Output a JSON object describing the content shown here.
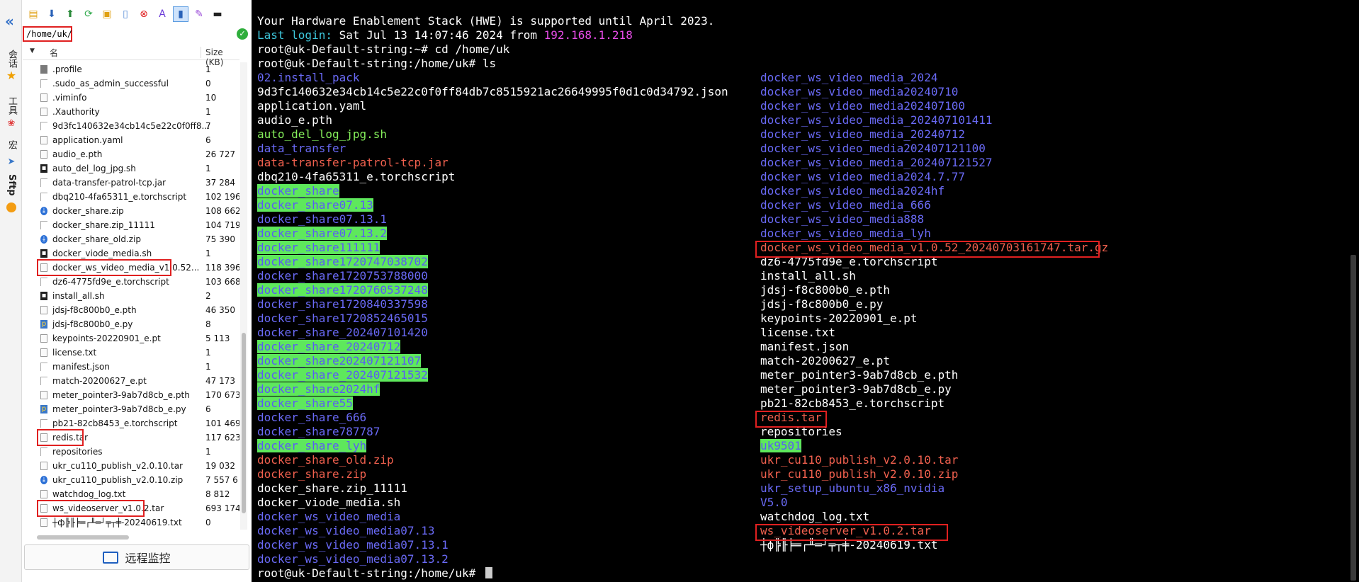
{
  "sidebar": {
    "tabs": [
      "会话",
      "工具",
      "宏",
      "Sftp"
    ]
  },
  "path": "/home/uk/",
  "columns": {
    "name": "名",
    "size": "Size (KB)"
  },
  "files": [
    {
      "name": ".profile",
      "size": "1",
      "icon": "db"
    },
    {
      "name": ".sudo_as_admin_successful",
      "size": "0",
      "icon": "blank"
    },
    {
      "name": ".viminfo",
      "size": "10",
      "icon": "doc"
    },
    {
      "name": ".Xauthority",
      "size": "1",
      "icon": "doc"
    },
    {
      "name": "9d3fc140632e34cb14c5e22c0f0ff8...",
      "size": "7",
      "icon": "blank"
    },
    {
      "name": "application.yaml",
      "size": "6",
      "icon": "doc"
    },
    {
      "name": "audio_e.pth",
      "size": "26 727",
      "icon": "doc"
    },
    {
      "name": "auto_del_log_jpg.sh",
      "size": "1",
      "icon": "term"
    },
    {
      "name": "data-transfer-patrol-tcp.jar",
      "size": "37 284",
      "icon": "blank"
    },
    {
      "name": "dbq210-4fa65311_e.torchscript",
      "size": "102 196",
      "icon": "blank"
    },
    {
      "name": "docker_share.zip",
      "size": "108 662",
      "icon": "zip"
    },
    {
      "name": "docker_share.zip_11111",
      "size": "104 719",
      "icon": "blank"
    },
    {
      "name": "docker_share_old.zip",
      "size": "75 390",
      "icon": "zip"
    },
    {
      "name": "docker_viode_media.sh",
      "size": "1",
      "icon": "term"
    },
    {
      "name": "docker_ws_video_media_v1.0.52...",
      "size": "118 396",
      "icon": "doc"
    },
    {
      "name": "dz6-4775fd9e_e.torchscript",
      "size": "103 668",
      "icon": "blank"
    },
    {
      "name": "install_all.sh",
      "size": "2",
      "icon": "term"
    },
    {
      "name": "jdsj-f8c800b0_e.pth",
      "size": "46 350",
      "icon": "doc"
    },
    {
      "name": "jdsj-f8c800b0_e.py",
      "size": "8",
      "icon": "py"
    },
    {
      "name": "keypoints-20220901_e.pt",
      "size": "5 113",
      "icon": "doc"
    },
    {
      "name": "license.txt",
      "size": "1",
      "icon": "doc"
    },
    {
      "name": "manifest.json",
      "size": "1",
      "icon": "blank"
    },
    {
      "name": "match-20200627_e.pt",
      "size": "47 173",
      "icon": "blank"
    },
    {
      "name": "meter_pointer3-9ab7d8cb_e.pth",
      "size": "170 673",
      "icon": "doc"
    },
    {
      "name": "meter_pointer3-9ab7d8cb_e.py",
      "size": "6",
      "icon": "py"
    },
    {
      "name": "pb21-82cb8453_e.torchscript",
      "size": "101 469",
      "icon": "blank"
    },
    {
      "name": "redis.tar",
      "size": "117 623",
      "icon": "doc"
    },
    {
      "name": "repositories",
      "size": "1",
      "icon": "blank"
    },
    {
      "name": "ukr_cu110_publish_v2.0.10.tar",
      "size": "19 032",
      "icon": "doc"
    },
    {
      "name": "ukr_cu110_publish_v2.0.10.zip",
      "size": "7 557 6",
      "icon": "zip"
    },
    {
      "name": "watchdog_log.txt",
      "size": "8 812",
      "icon": "doc"
    },
    {
      "name": "ws_videoserver_v1.0.2.tar",
      "size": "693 174",
      "icon": "doc"
    },
    {
      "name": "┼ф╠╟╞═┌╨═┘╤┬╪-20240619.txt",
      "size": "0",
      "icon": "doc"
    }
  ],
  "monitor_label": "远程监控",
  "terminal": {
    "hwe": "Your Hardware Enablement Stack (HWE) is supported until April 2023.",
    "login_label": "Last login:",
    "login_date": " Sat Jul 13 14:07:46 2024 from ",
    "login_ip": "192.168.1.218",
    "prompt_home": "root@uk-Default-string:~# ",
    "cmd_cd": "cd /home/uk",
    "prompt_uk": "root@uk-Default-string:/home/uk# ",
    "cmd_ls": "ls",
    "col1": [
      {
        "t": "02.install_pack",
        "c": "dir"
      },
      {
        "t": "9d3fc140632e34cb14c5e22c0f0ff84db7c8515921ac26649995f0d1c0d34792.json",
        "c": "w"
      },
      {
        "t": "application.yaml",
        "c": "w"
      },
      {
        "t": "audio_e.pth",
        "c": "w"
      },
      {
        "t": "auto_del_log_jpg.sh",
        "c": "exec"
      },
      {
        "t": "data_transfer",
        "c": "dir"
      },
      {
        "t": "data-transfer-patrol-tcp.jar",
        "c": "red"
      },
      {
        "t": "dbq210-4fa65311_e.torchscript",
        "c": "w"
      },
      {
        "t": "docker_share",
        "c": "g"
      },
      {
        "t": "docker_share07.13",
        "c": "g"
      },
      {
        "t": "docker_share07.13.1",
        "c": "dir"
      },
      {
        "t": "docker_share07.13.2",
        "c": "g"
      },
      {
        "t": "docker_share111111",
        "c": "g"
      },
      {
        "t": "docker_share1720747038702",
        "c": "g"
      },
      {
        "t": "docker_share1720753788000",
        "c": "dir"
      },
      {
        "t": "docker_share1720760537248",
        "c": "g"
      },
      {
        "t": "docker_share1720840337598",
        "c": "dir"
      },
      {
        "t": "docker_share1720852465015",
        "c": "dir"
      },
      {
        "t": "docker_share_202407101420",
        "c": "dir"
      },
      {
        "t": "docker_share_20240712",
        "c": "g"
      },
      {
        "t": "docker_share202407121107",
        "c": "g"
      },
      {
        "t": "docker_share_202407121532",
        "c": "g"
      },
      {
        "t": "docker_share2024hf",
        "c": "g"
      },
      {
        "t": "docker_share55",
        "c": "g"
      },
      {
        "t": "docker_share_666",
        "c": "dir"
      },
      {
        "t": "docker_share787787",
        "c": "dir"
      },
      {
        "t": "docker_share_lyh",
        "c": "g"
      },
      {
        "t": "docker_share_old.zip",
        "c": "red"
      },
      {
        "t": "docker_share.zip",
        "c": "red"
      },
      {
        "t": "docker_share.zip_11111",
        "c": "w"
      },
      {
        "t": "docker_viode_media.sh",
        "c": "w"
      },
      {
        "t": "docker_ws_video_media",
        "c": "dir"
      },
      {
        "t": "docker_ws_video_media07.13",
        "c": "dir"
      },
      {
        "t": "docker_ws_video_media07.13.1",
        "c": "dir"
      },
      {
        "t": "docker_ws_video_media07.13.2",
        "c": "dir"
      }
    ],
    "col2": [
      {
        "t": "docker_ws_video_media_2024",
        "c": "dir"
      },
      {
        "t": "docker_ws_video_media20240710",
        "c": "dir"
      },
      {
        "t": "docker_ws_video_media202407100",
        "c": "dir"
      },
      {
        "t": "docker_ws_video_media_202407101411",
        "c": "dir"
      },
      {
        "t": "docker_ws_video_media_20240712",
        "c": "dir"
      },
      {
        "t": "docker_ws_video_media202407121100",
        "c": "dir"
      },
      {
        "t": "docker_ws_video_media_202407121527",
        "c": "dir"
      },
      {
        "t": "docker_ws_video_media2024.7.77",
        "c": "dir"
      },
      {
        "t": "docker_ws_video_media2024hf",
        "c": "dir"
      },
      {
        "t": "docker_ws_video_media_666",
        "c": "dir"
      },
      {
        "t": "docker_ws_video_media888",
        "c": "dir"
      },
      {
        "t": "docker_ws_video_media_lyh",
        "c": "dir"
      },
      {
        "t": "docker_ws_video_media_v1.0.52_20240703161747.tar.gz",
        "c": "red"
      },
      {
        "t": "dz6-4775fd9e_e.torchscript",
        "c": "w"
      },
      {
        "t": "install_all.sh",
        "c": "w"
      },
      {
        "t": "jdsj-f8c800b0_e.pth",
        "c": "w"
      },
      {
        "t": "jdsj-f8c800b0_e.py",
        "c": "w"
      },
      {
        "t": "keypoints-20220901_e.pt",
        "c": "w"
      },
      {
        "t": "license.txt",
        "c": "w"
      },
      {
        "t": "manifest.json",
        "c": "w"
      },
      {
        "t": "match-20200627_e.pt",
        "c": "w"
      },
      {
        "t": "meter_pointer3-9ab7d8cb_e.pth",
        "c": "w"
      },
      {
        "t": "meter_pointer3-9ab7d8cb_e.py",
        "c": "w"
      },
      {
        "t": "pb21-82cb8453_e.torchscript",
        "c": "w"
      },
      {
        "t": "redis.tar",
        "c": "red"
      },
      {
        "t": "repositories",
        "c": "w"
      },
      {
        "t": "uk9501",
        "c": "g"
      },
      {
        "t": "ukr_cu110_publish_v2.0.10.tar",
        "c": "red"
      },
      {
        "t": "ukr_cu110_publish_v2.0.10.zip",
        "c": "red"
      },
      {
        "t": "ukr_setup_ubuntu_x86_nvidia",
        "c": "dir"
      },
      {
        "t": "V5.0",
        "c": "dir"
      },
      {
        "t": "watchdog_log.txt",
        "c": "w"
      },
      {
        "t": "ws_videoserver_v1.0.2.tar",
        "c": "red"
      },
      {
        "t": "┼ф╠╟╞═┌╨═┘╤┬╪-20240619.txt",
        "c": "w"
      }
    ]
  }
}
